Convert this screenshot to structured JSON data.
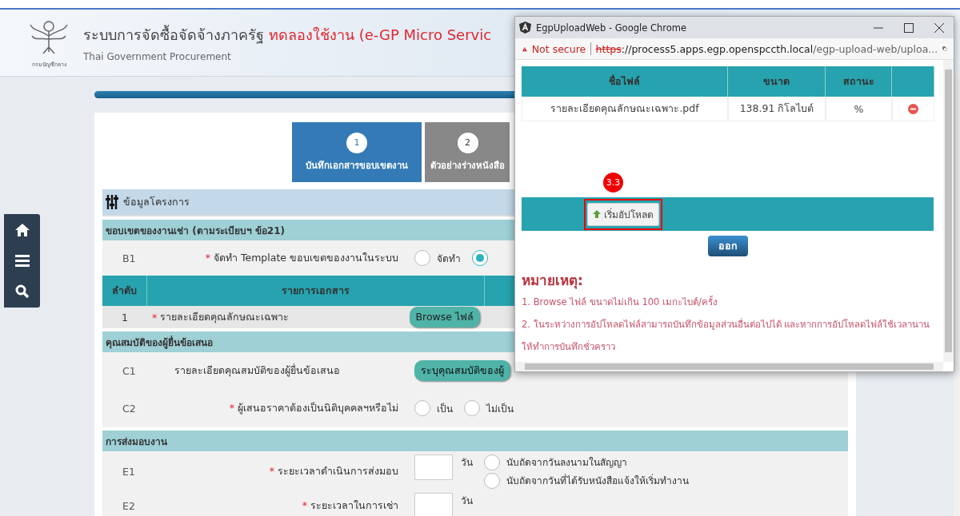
{
  "header": {
    "logo_caption": "กรมบัญชีกลาง",
    "title": "ระบบการจัดซื้อจัดจ้างภาครัฐ",
    "title_note": "ทดลองใช้งาน (e-GP Micro Servic",
    "subtitle": "Thai Government Procurement"
  },
  "steps": [
    {
      "number": "1",
      "label": "บันทึกเอกสารขอบเขตงาน",
      "selected": true
    },
    {
      "number": "2",
      "label": "ตัวอย่างร่างหนังสือ",
      "selected": false
    }
  ],
  "project_section": {
    "title": "ข้อมูลโครงการ"
  },
  "sections": [
    {
      "title": "ขอบเขตของงานเช่า (ตามระเบียบฯ ข้อ21)",
      "rows": [
        {
          "kind": "radio",
          "code": "B1",
          "label": "จัดทำ Template ขอบเขตของงานในระบบ",
          "mark": "*",
          "options": [
            {
              "label": "จัดทำ",
              "selected": false
            },
            {
              "selected": true
            }
          ]
        },
        {
          "kind": "table",
          "columns": [
            "ลำดับ",
            "รายการเอกสาร"
          ],
          "rows": [
            {
              "index": "1",
              "label": "รายละเอียดคุณลักษณะเฉพาะ",
              "mark": "*",
              "button": "Browse ไฟล์"
            }
          ]
        }
      ]
    },
    {
      "title": "คุณสมบัติของผู้ยื่นข้อเสนอ",
      "rows": [
        {
          "kind": "button",
          "code": "C1",
          "label": "รายละเอียดคุณสมบัติของผู้ยื่นข้อเสนอ",
          "button": "ระบุคุณสมบัติของผู้"
        },
        {
          "kind": "radio",
          "code": "C2",
          "label": "ผู้เสนอราคาต้องเป็นนิติบุคคลฯหรือไม่",
          "mark": "*",
          "options": [
            {
              "label": "เป็น",
              "selected": false
            },
            {
              "label": "ไม่เป็น",
              "selected": false
            }
          ]
        }
      ]
    },
    {
      "title": "การส่งมอบงาน",
      "rows": [
        {
          "kind": "duration",
          "code": "E1",
          "label": "ระยะเวลาดำเนินการส่งมอบ",
          "mark": "*",
          "unit": "วัน",
          "options": [
            {
              "label": "นับถัดจากวันลงนามในสัญญา",
              "selected": false
            },
            {
              "label": "นับถัดจากวันที่ได้รับหนังสือแจ้งให้เริ่มทำงาน",
              "selected": false
            }
          ]
        },
        {
          "kind": "duration",
          "code": "E2",
          "label": "ระยะเวลาในการเช่า",
          "mark": "*",
          "unit": "วัน"
        }
      ]
    }
  ],
  "popup": {
    "title": "EgpUploadWeb - Google Chrome",
    "security": "Not secure",
    "url": {
      "scheme": "https",
      "host": "://process5.apps.egp.openspccth.local",
      "path": "/egp-upload-web/uploa..."
    },
    "table": {
      "columns": [
        "ชื่อไฟล์",
        "ขนาด",
        "สถานะ"
      ],
      "rows": [
        {
          "name": "รายละเอียดคุณลักษณะเฉพาะ.pdf",
          "size": "138.91 กิโลไบต์",
          "status": "%"
        }
      ]
    },
    "step_badge": "3.3",
    "upload_button": "เริ่มอัปโหลด",
    "exit_button": "ออก",
    "notes_title": "หมายเหตุ:",
    "notes": [
      "1. Browse ไฟล์ ขนาดไม่เกิน 100 เมกะไบต์/ครั้ง",
      "2. ในระหว่างการอัปโหลดไฟล์สามารถบันทึกข้อมูลส่วนอื่นต่อไปได้ และหากการอัปโหลดไฟล์ใช้เวลานาน ให้ทำการบันทึกชั่วคราว"
    ]
  }
}
